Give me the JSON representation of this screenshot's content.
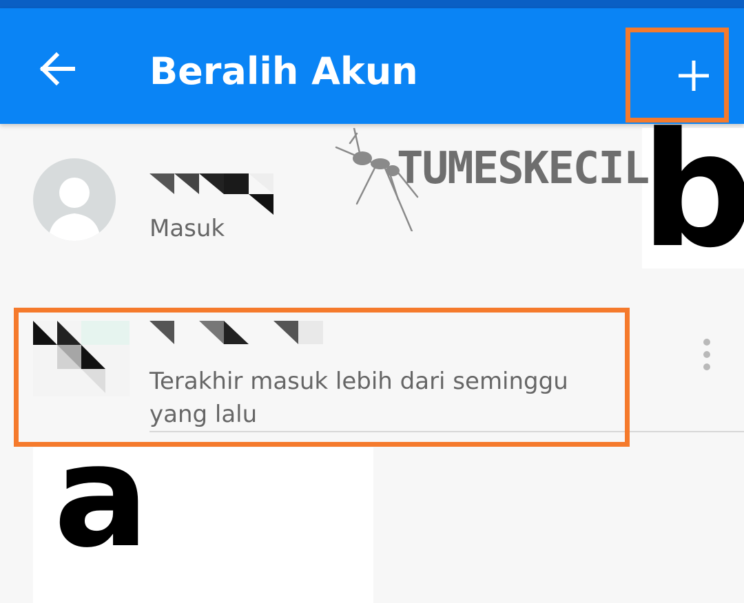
{
  "app_bar": {
    "title": "Beralih Akun",
    "back_icon": "arrow-left-icon",
    "add_icon": "plus-icon",
    "color": "#0a84f5"
  },
  "watermark": {
    "text": "TUMESKECIL",
    "icon": "ant-icon"
  },
  "accounts": [
    {
      "name": "",
      "status": "Masuk",
      "avatar_icon": "default-person-icon"
    },
    {
      "name": "",
      "status": "Terakhir masuk lebih dari seminggu yang lalu",
      "menu_icon": "more-vertical-icon"
    }
  ],
  "annotations": {
    "label_a": "a",
    "label_b": "b",
    "highlight_color": "#f57a2c"
  }
}
